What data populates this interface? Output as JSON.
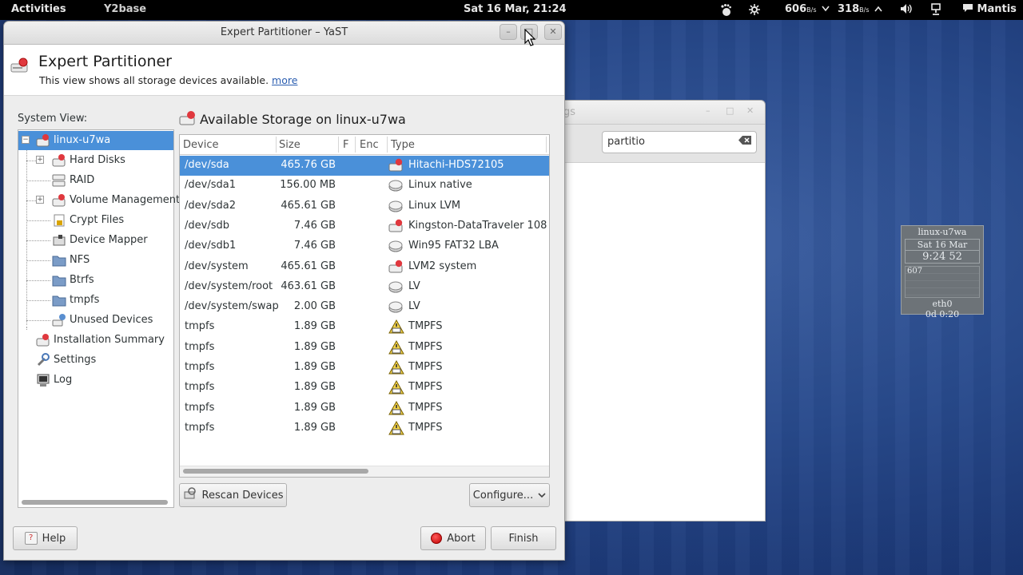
{
  "topbar": {
    "activities": "Activities",
    "app_name": "Y2base",
    "clock": "Sat 16 Mar, 21:24",
    "net_down_value": "606",
    "net_down_unit": "B/s",
    "net_up_value": "318",
    "net_up_unit": "B/s",
    "user": "Mantis"
  },
  "background_window": {
    "title_fragment": "gs",
    "search_value": "partitio"
  },
  "conky": {
    "host": "linux-u7wa",
    "date": "Sat 16 Mar",
    "time": "9:24 52",
    "graph_label": "607",
    "iface": "eth0",
    "uptime": "0d 0:20"
  },
  "window": {
    "title": "Expert Partitioner – YaST",
    "heading": "Expert Partitioner",
    "subtitle": "This view shows all storage devices available.",
    "more_link": "more"
  },
  "system_view": {
    "label": "System View:",
    "items": [
      {
        "label": "linux-u7wa",
        "icon": "computer-disk-icon"
      },
      {
        "label": "Hard Disks",
        "icon": "hard-disk-icon"
      },
      {
        "label": "RAID",
        "icon": "raid-icon"
      },
      {
        "label": "Volume Management",
        "icon": "volume-management-icon"
      },
      {
        "label": "Crypt Files",
        "icon": "crypt-files-icon"
      },
      {
        "label": "Device Mapper",
        "icon": "device-mapper-icon"
      },
      {
        "label": "NFS",
        "icon": "nfs-icon"
      },
      {
        "label": "Btrfs",
        "icon": "btrfs-icon"
      },
      {
        "label": "tmpfs",
        "icon": "tmpfs-icon"
      },
      {
        "label": "Unused Devices",
        "icon": "unused-devices-icon"
      },
      {
        "label": "Installation Summary",
        "icon": "installation-summary-icon"
      },
      {
        "label": "Settings",
        "icon": "settings-icon"
      },
      {
        "label": "Log",
        "icon": "log-icon"
      }
    ]
  },
  "storage": {
    "title": "Available Storage on linux-u7wa",
    "columns": {
      "device": "Device",
      "size": "Size",
      "f": "F",
      "enc": "Enc",
      "type": "Type"
    },
    "rows": [
      {
        "device": "/dev/sda",
        "size": "465.76 GB",
        "type": "Hitachi-HDS72105",
        "icon": "hard-disk-icon"
      },
      {
        "device": "/dev/sda1",
        "size": "156.00 MB",
        "type": "Linux native",
        "icon": "partition-icon"
      },
      {
        "device": "/dev/sda2",
        "size": "465.61 GB",
        "type": "Linux LVM",
        "icon": "partition-icon"
      },
      {
        "device": "/dev/sdb",
        "size": "7.46 GB",
        "type": "Kingston-DataTraveler 108",
        "icon": "hard-disk-icon"
      },
      {
        "device": "/dev/sdb1",
        "size": "7.46 GB",
        "type": "Win95 FAT32 LBA",
        "icon": "partition-icon"
      },
      {
        "device": "/dev/system",
        "size": "465.61 GB",
        "type": "LVM2 system",
        "icon": "hard-disk-icon"
      },
      {
        "device": "/dev/system/root",
        "size": "463.61 GB",
        "type": "LV",
        "icon": "partition-icon"
      },
      {
        "device": "/dev/system/swap",
        "size": "2.00 GB",
        "type": "LV",
        "icon": "partition-icon"
      },
      {
        "device": "tmpfs",
        "size": "1.89 GB",
        "type": "TMPFS",
        "icon": "tmpfs-warning-icon"
      },
      {
        "device": "tmpfs",
        "size": "1.89 GB",
        "type": "TMPFS",
        "icon": "tmpfs-warning-icon"
      },
      {
        "device": "tmpfs",
        "size": "1.89 GB",
        "type": "TMPFS",
        "icon": "tmpfs-warning-icon"
      },
      {
        "device": "tmpfs",
        "size": "1.89 GB",
        "type": "TMPFS",
        "icon": "tmpfs-warning-icon"
      },
      {
        "device": "tmpfs",
        "size": "1.89 GB",
        "type": "TMPFS",
        "icon": "tmpfs-warning-icon"
      },
      {
        "device": "tmpfs",
        "size": "1.89 GB",
        "type": "TMPFS",
        "icon": "tmpfs-warning-icon"
      }
    ]
  },
  "buttons": {
    "rescan": "Rescan Devices",
    "configure": "Configure...",
    "help": "Help",
    "abort": "Abort",
    "finish": "Finish"
  },
  "colors": {
    "selection": "#4a90d9",
    "link": "#2a5db0",
    "abort_red": "#c00000"
  }
}
